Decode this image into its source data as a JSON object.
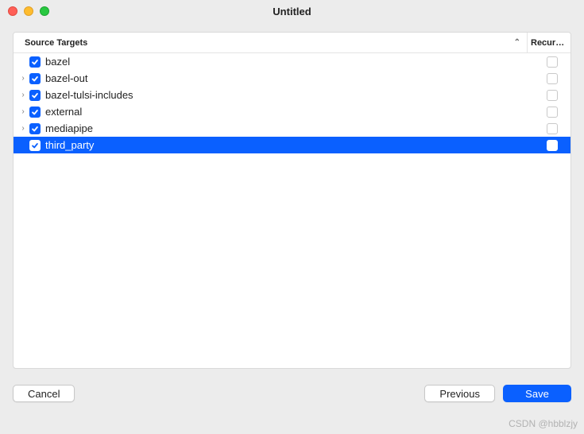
{
  "window": {
    "title": "Untitled"
  },
  "table": {
    "headers": {
      "name": "Source Targets",
      "recursive": "Recursi…"
    },
    "rows": [
      {
        "label": "bazel",
        "checked": true,
        "expandable": false,
        "recursive": false,
        "selected": false
      },
      {
        "label": "bazel-out",
        "checked": true,
        "expandable": true,
        "recursive": false,
        "selected": false
      },
      {
        "label": "bazel-tulsi-includes",
        "checked": true,
        "expandable": true,
        "recursive": false,
        "selected": false
      },
      {
        "label": "external",
        "checked": true,
        "expandable": true,
        "recursive": false,
        "selected": false
      },
      {
        "label": "mediapipe",
        "checked": true,
        "expandable": true,
        "recursive": false,
        "selected": false
      },
      {
        "label": "third_party",
        "checked": true,
        "expandable": false,
        "recursive": false,
        "selected": true
      }
    ]
  },
  "buttons": {
    "cancel": "Cancel",
    "previous": "Previous",
    "save": "Save"
  },
  "watermark": "CSDN @hbblzjy"
}
